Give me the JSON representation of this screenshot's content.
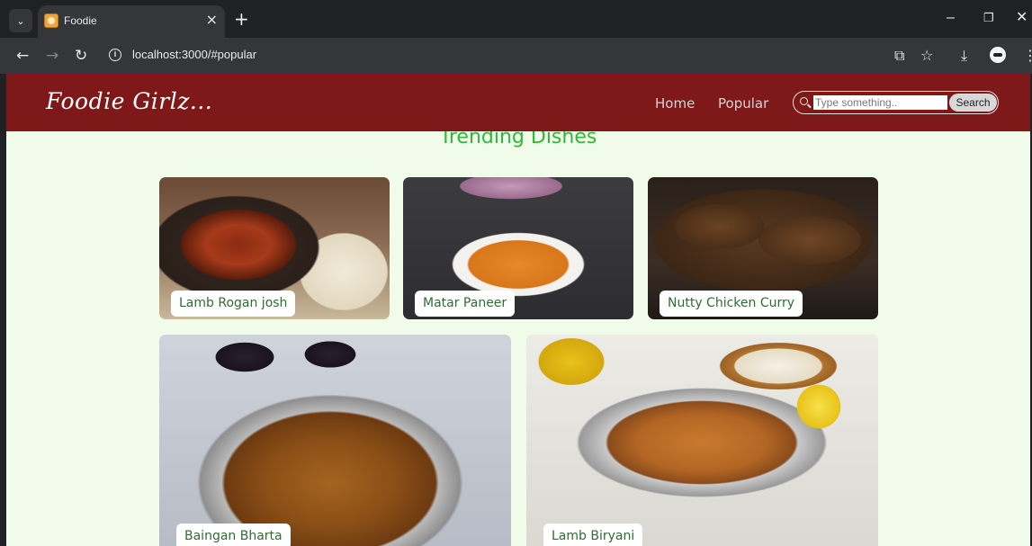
{
  "browser": {
    "tab": {
      "title": "Foodie"
    },
    "new_tab_glyph": "+",
    "close_tab_glyph": "×",
    "url": "localhost:3000/#popular",
    "icons": [
      "chevron-down-icon",
      "back-icon",
      "forward-icon",
      "reload-icon",
      "info-icon",
      "cast-icon",
      "star-icon",
      "download-icon",
      "profile-icon",
      "more-icon",
      "minimize-icon",
      "restore-icon",
      "close-icon"
    ]
  },
  "site": {
    "logo": "Foodie Girlz...",
    "nav": [
      {
        "label": "Home"
      },
      {
        "label": "Popular"
      }
    ],
    "search": {
      "placeholder": "Type something..",
      "button_label": "Search"
    }
  },
  "section": {
    "title": "Trending Dishes"
  },
  "dishes": [
    {
      "name": "Lamb Rogan josh"
    },
    {
      "name": "Matar Paneer"
    },
    {
      "name": "Nutty Chicken Curry"
    },
    {
      "name": "Baingan Bharta"
    },
    {
      "name": "Lamb Biryani"
    }
  ],
  "colors": {
    "header_bg": "#7f1818",
    "page_bg": "#f1fbea",
    "title_green": "#31b73a",
    "label_green": "#2f6b34"
  }
}
